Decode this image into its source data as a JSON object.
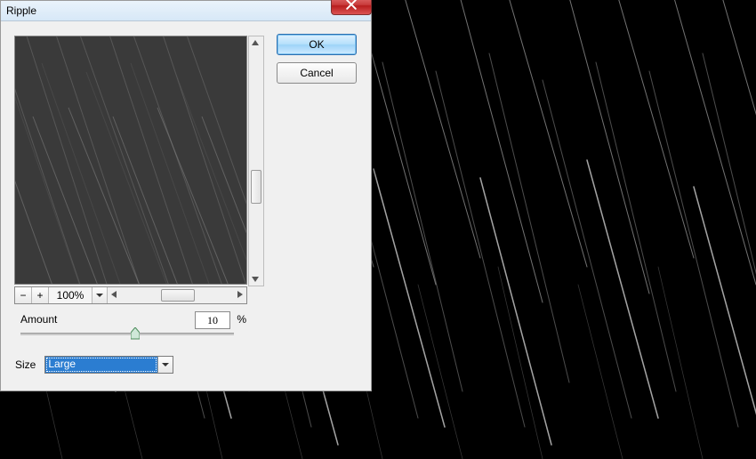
{
  "dialog": {
    "title": "Ripple",
    "ok_label": "OK",
    "cancel_label": "Cancel",
    "zoom_value": "100%",
    "amount_label": "Amount",
    "amount_value": "10",
    "amount_unit": "%",
    "size_label": "Size",
    "size_value": "Large"
  },
  "icons": {
    "close": "close-icon",
    "minus": "−",
    "plus": "+"
  }
}
